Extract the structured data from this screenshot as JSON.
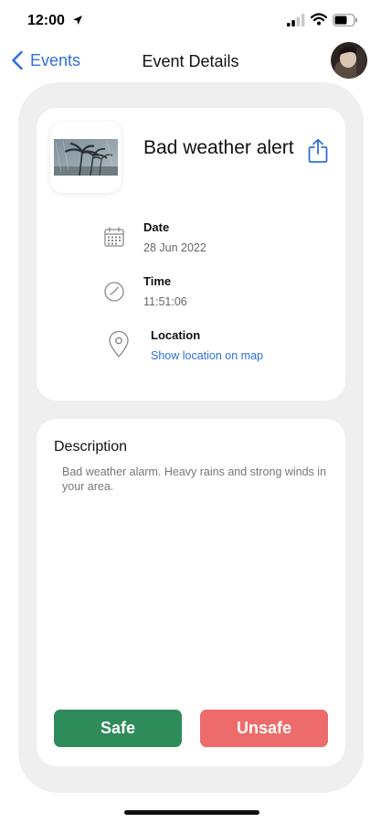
{
  "status_bar": {
    "time": "12:00"
  },
  "nav": {
    "back_label": "Events",
    "title": "Event Details"
  },
  "event": {
    "title": "Bad weather alert",
    "details": {
      "date_label": "Date",
      "date_value": "28 Jun 2022",
      "time_label": "Time",
      "time_value": "11:51:06",
      "location_label": "Location",
      "location_link": "Show location on map"
    }
  },
  "description": {
    "title": "Description",
    "text": "Bad weather alarm. Heavy rains and strong winds in your area."
  },
  "actions": {
    "safe_label": "Safe",
    "unsafe_label": "Unsafe"
  },
  "colors": {
    "accent": "#2f6fdb",
    "safe": "#2e8b5a",
    "unsafe": "#ee6b6b",
    "panel_bg": "#efefef"
  },
  "icons": [
    "location-arrow-icon",
    "signal-icon",
    "wifi-icon",
    "battery-icon",
    "chevron-left-icon",
    "share-icon",
    "calendar-icon",
    "clock-icon",
    "map-pin-icon"
  ]
}
